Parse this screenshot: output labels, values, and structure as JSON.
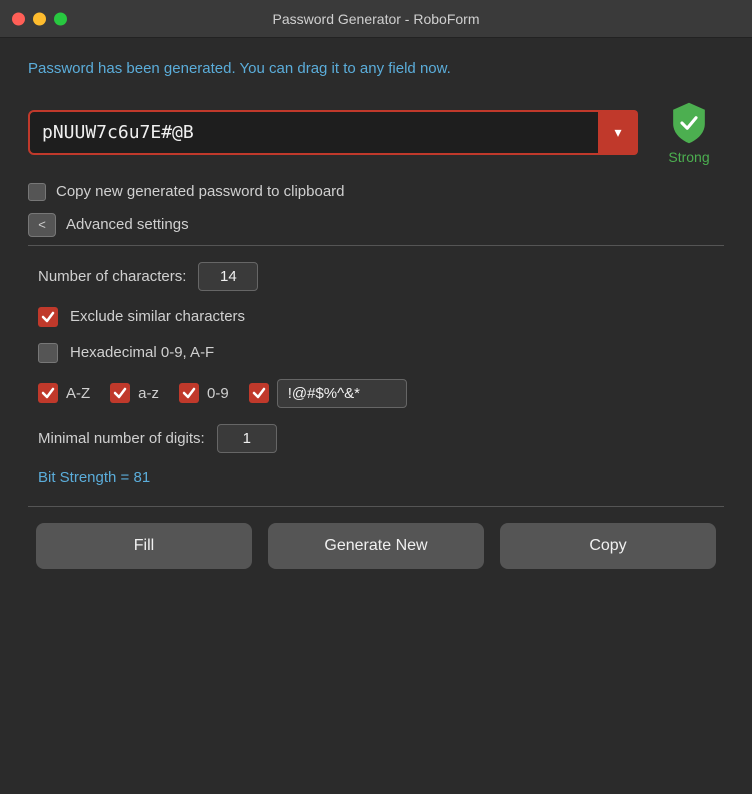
{
  "titleBar": {
    "title": "Password Generator - RoboForm"
  },
  "infoText": "Password has been generated. You can drag it to any field now.",
  "passwordField": {
    "value": "pNUUW7c6u7E#@B",
    "dropdownArrow": "▾"
  },
  "strengthBadge": {
    "label": "Strong"
  },
  "clipboardCheckbox": {
    "label": "Copy new generated password to clipboard",
    "checked": false
  },
  "advancedSettings": {
    "toggleLabel": "<",
    "sectionLabel": "Advanced settings"
  },
  "settings": {
    "numCharsLabel": "Number of characters:",
    "numCharsValue": "14",
    "excludeSimilarLabel": "Exclude similar characters",
    "excludeSimilarChecked": true,
    "hexDecimalLabel": "Hexadecimal 0-9, A-F",
    "hexDecimalChecked": false,
    "azLabel": "A-Z",
    "azChecked": true,
    "azLowerLabel": "a-z",
    "azLowerChecked": true,
    "digitsLabel": "0-9",
    "digitsChecked": true,
    "specialChecked": true,
    "specialValue": "!@#$%^&*",
    "minDigitsLabel": "Minimal number of digits:",
    "minDigitsValue": "1",
    "bitStrengthLabel": "Bit Strength = 81"
  },
  "buttons": {
    "fill": "Fill",
    "generateNew": "Generate New",
    "copy": "Copy"
  }
}
